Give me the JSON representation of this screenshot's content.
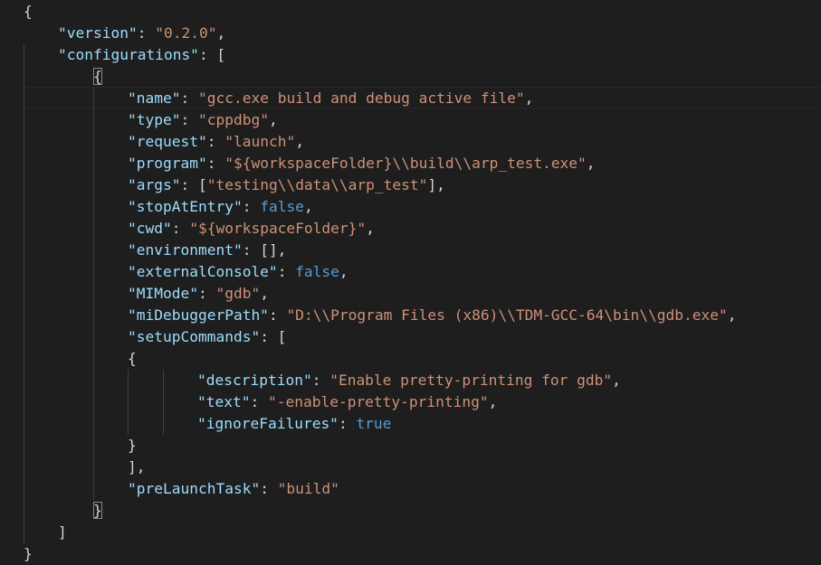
{
  "editor": {
    "language": "json",
    "colors": {
      "background": "#1e1e1e",
      "key": "#9cdcfe",
      "string": "#ce9178",
      "boolean": "#569cd6",
      "punctuation": "#d4d4d4"
    },
    "lines": [
      [
        {
          "t": "p",
          "v": "{"
        }
      ],
      [
        {
          "t": "k",
          "v": "\"version\""
        },
        {
          "t": "p",
          "v": ": "
        },
        {
          "t": "s",
          "v": "\"0.2.0\""
        },
        {
          "t": "p",
          "v": ","
        }
      ],
      [
        {
          "t": "k",
          "v": "\"configurations\""
        },
        {
          "t": "p",
          "v": ": ["
        }
      ],
      [
        {
          "t": "p",
          "v": "{",
          "m": true
        }
      ],
      [
        {
          "t": "k",
          "v": "\"name\""
        },
        {
          "t": "p",
          "v": ": "
        },
        {
          "t": "s",
          "v": "\"gcc.exe build and debug active file\""
        },
        {
          "t": "p",
          "v": ","
        }
      ],
      [
        {
          "t": "k",
          "v": "\"type\""
        },
        {
          "t": "p",
          "v": ": "
        },
        {
          "t": "s",
          "v": "\"cppdbg\""
        },
        {
          "t": "p",
          "v": ","
        }
      ],
      [
        {
          "t": "k",
          "v": "\"request\""
        },
        {
          "t": "p",
          "v": ": "
        },
        {
          "t": "s",
          "v": "\"launch\""
        },
        {
          "t": "p",
          "v": ","
        }
      ],
      [
        {
          "t": "k",
          "v": "\"program\""
        },
        {
          "t": "p",
          "v": ": "
        },
        {
          "t": "s",
          "v": "\"${workspaceFolder}\\\\build\\\\arp_test.exe\""
        },
        {
          "t": "p",
          "v": ","
        }
      ],
      [
        {
          "t": "k",
          "v": "\"args\""
        },
        {
          "t": "p",
          "v": ": ["
        },
        {
          "t": "s",
          "v": "\"testing\\\\data\\\\arp_test\""
        },
        {
          "t": "p",
          "v": "],"
        }
      ],
      [
        {
          "t": "k",
          "v": "\"stopAtEntry\""
        },
        {
          "t": "p",
          "v": ": "
        },
        {
          "t": "b",
          "v": "false"
        },
        {
          "t": "p",
          "v": ","
        }
      ],
      [
        {
          "t": "k",
          "v": "\"cwd\""
        },
        {
          "t": "p",
          "v": ": "
        },
        {
          "t": "s",
          "v": "\"${workspaceFolder}\""
        },
        {
          "t": "p",
          "v": ","
        }
      ],
      [
        {
          "t": "k",
          "v": "\"environment\""
        },
        {
          "t": "p",
          "v": ": [],"
        }
      ],
      [
        {
          "t": "k",
          "v": "\"externalConsole\""
        },
        {
          "t": "p",
          "v": ": "
        },
        {
          "t": "b",
          "v": "false"
        },
        {
          "t": "p",
          "v": ","
        }
      ],
      [
        {
          "t": "k",
          "v": "\"MIMode\""
        },
        {
          "t": "p",
          "v": ": "
        },
        {
          "t": "s",
          "v": "\"gdb\""
        },
        {
          "t": "p",
          "v": ","
        }
      ],
      [
        {
          "t": "k",
          "v": "\"miDebuggerPath\""
        },
        {
          "t": "p",
          "v": ": "
        },
        {
          "t": "s",
          "v": "\"D:\\\\Program Files (x86)\\\\TDM-GCC-64\\bin\\\\gdb.exe\""
        },
        {
          "t": "p",
          "v": ","
        }
      ],
      [
        {
          "t": "k",
          "v": "\"setupCommands\""
        },
        {
          "t": "p",
          "v": ": ["
        }
      ],
      [
        {
          "t": "p",
          "v": "{"
        }
      ],
      [
        {
          "t": "k",
          "v": "\"description\""
        },
        {
          "t": "p",
          "v": ": "
        },
        {
          "t": "s",
          "v": "\"Enable pretty-printing for gdb\""
        },
        {
          "t": "p",
          "v": ","
        }
      ],
      [
        {
          "t": "k",
          "v": "\"text\""
        },
        {
          "t": "p",
          "v": ": "
        },
        {
          "t": "s",
          "v": "\"-enable-pretty-printing\""
        },
        {
          "t": "p",
          "v": ","
        }
      ],
      [
        {
          "t": "k",
          "v": "\"ignoreFailures\""
        },
        {
          "t": "p",
          "v": ": "
        },
        {
          "t": "b",
          "v": "true"
        }
      ],
      [
        {
          "t": "p",
          "v": "}"
        }
      ],
      [
        {
          "t": "p",
          "v": "],"
        }
      ],
      [
        {
          "t": "k",
          "v": "\"preLaunchTask\""
        },
        {
          "t": "p",
          "v": ": "
        },
        {
          "t": "s",
          "v": "\"build\""
        }
      ],
      [
        {
          "t": "p",
          "v": "}",
          "m": true
        }
      ],
      [
        {
          "t": "p",
          "v": "]"
        }
      ],
      [
        {
          "t": "p",
          "v": "}"
        }
      ]
    ]
  }
}
